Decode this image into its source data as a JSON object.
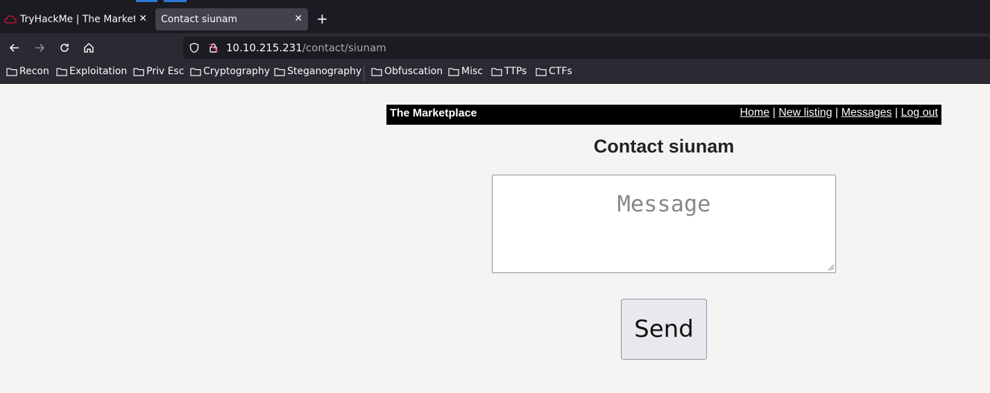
{
  "browser": {
    "tabs": [
      {
        "title": "TryHackMe | The Marketplace",
        "active": false
      },
      {
        "title": "Contact siunam",
        "active": true
      }
    ],
    "close_glyph": "✕",
    "new_tab_glyph": "+",
    "nav": {
      "back_icon": "arrow-left",
      "forward_icon": "arrow-right",
      "reload_icon": "reload",
      "home_icon": "home"
    },
    "url": {
      "host": "10.10.215.231",
      "path": "/contact/siunam"
    },
    "bookmarks": [
      "Recon",
      "Exploitation",
      "Priv Esc",
      "Cryptography",
      "Steganography",
      "Obfuscation",
      "Misc",
      "TTPs",
      "CTFs"
    ]
  },
  "site": {
    "title": "The Marketplace",
    "nav": {
      "home": "Home",
      "new_listing": "New listing",
      "messages": "Messages",
      "logout": "Log out",
      "separator": "|"
    }
  },
  "contact": {
    "heading": "Contact siunam",
    "message_placeholder": "Message",
    "send_label": "Send"
  },
  "colors": {
    "tab_accent": "#2a79d4",
    "header_bg": "#000000",
    "page_bg": "#f5f4f2"
  }
}
